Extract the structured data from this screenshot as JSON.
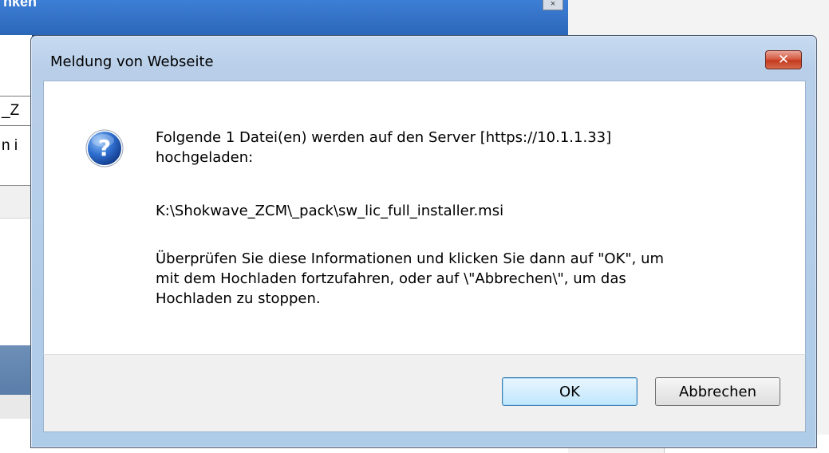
{
  "background": {
    "window_title": "nken",
    "field_text": "_Z",
    "row_text": "n i"
  },
  "dialog": {
    "title": "Meldung von Webseite",
    "close_glyph": "✕",
    "icon": "question-icon",
    "message_line1": "Folgende 1 Datei(en) werden auf den Server [https://10.1.1.33]\nhochgeladen:",
    "message_path": "K:\\Shokwave_ZCM\\_pack\\sw_lic_full_installer.msi",
    "message_info": "Überprüfen Sie diese Informationen und klicken Sie dann auf \"OK\", um\nmit dem Hochladen fortzufahren, oder auf \\\"Abbrechen\\\", um das\nHochladen zu stoppen.",
    "ok_label": "OK",
    "cancel_label": "Abbrechen"
  },
  "colors": {
    "close_button": "#c33a1f",
    "ok_border": "#3c7fb1",
    "dialog_frame": "#b9cfe9",
    "icon_blue": "#1f5bb8"
  }
}
